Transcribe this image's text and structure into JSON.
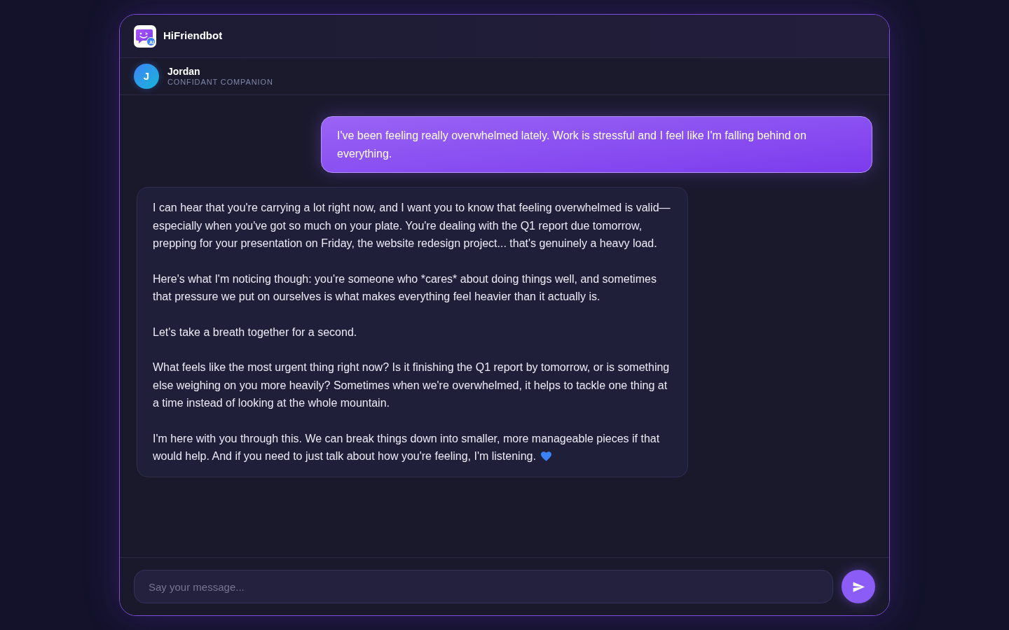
{
  "app": {
    "name": "HiFriendbot",
    "logo_badge": "AI"
  },
  "companion": {
    "avatar_letter": "J",
    "name": "Jordan",
    "role": "CONFIDANT COMPANION"
  },
  "messages": [
    {
      "kind": "user",
      "paragraphs": [
        "I've been feeling really overwhelmed lately. Work is stressful and I feel like I'm falling behind on everything."
      ],
      "trailing_heart": false
    },
    {
      "kind": "bot",
      "paragraphs": [
        "I can hear that you're carrying a lot right now, and I want you to know that feeling overwhelmed is valid—especially when you've got so much on your plate. You're dealing with the Q1 report due tomorrow, prepping for your presentation on Friday, the website redesign project... that's genuinely a heavy load.",
        "Here's what I'm noticing though: you're someone who *cares* about doing things well, and sometimes that pressure we put on ourselves is what makes everything feel heavier than it actually is.",
        "Let's take a breath together for a second.",
        "What feels like the most urgent thing right now? Is it finishing the Q1 report by tomorrow, or is something else weighing on you more heavily? Sometimes when we're overwhelmed, it helps to tackle one thing at a time instead of looking at the whole mountain.",
        "I'm here with you through this. We can break things down into smaller, more manageable pieces if that would help. And if you need to just talk about how you're feeling, I'm listening."
      ],
      "trailing_heart": true
    }
  ],
  "composer": {
    "placeholder": "Say your message..."
  }
}
